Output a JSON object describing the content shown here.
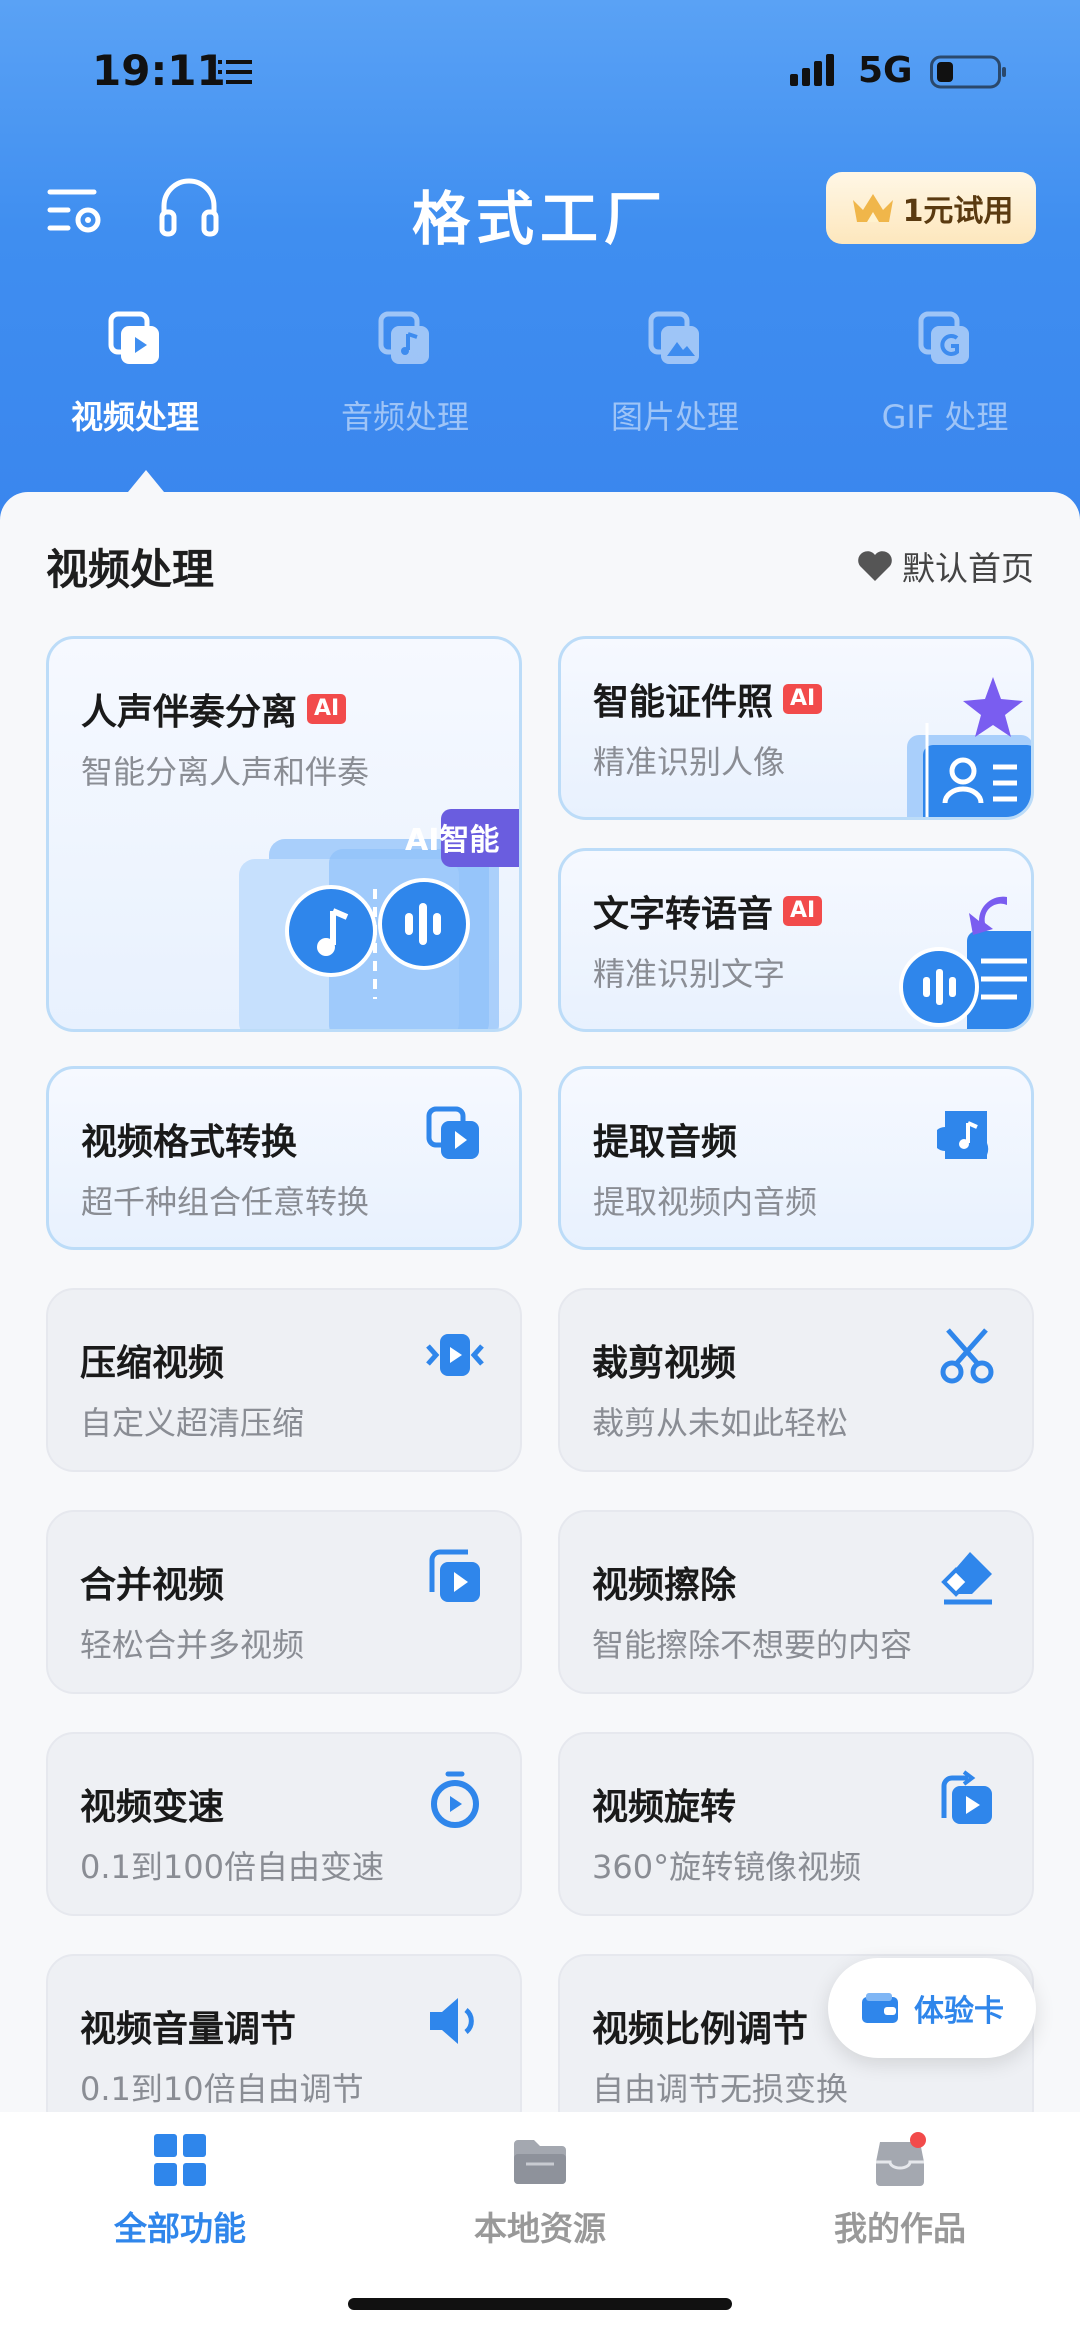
{
  "status_bar": {
    "time": "19:11",
    "network": "5G"
  },
  "top_bar": {
    "title": "格式工厂",
    "trial_button": "1元试用"
  },
  "categories": [
    {
      "label": "视频处理",
      "icon": "video-icon",
      "active": true
    },
    {
      "label": "音频处理",
      "icon": "audio-icon",
      "active": false
    },
    {
      "label": "图片处理",
      "icon": "image-icon",
      "active": false
    },
    {
      "label": "GIF 处理",
      "icon": "gif-icon",
      "active": false
    }
  ],
  "section": {
    "title": "视频处理",
    "default_home": "默认首页"
  },
  "feature_cards": {
    "vocal_separation": {
      "title": "人声伴奏分离",
      "subtitle": "智能分离人声和伴奏",
      "badge": "AI",
      "art_label": "AI智能"
    },
    "id_photo": {
      "title": "智能证件照",
      "subtitle": "精准识别人像",
      "badge": "AI"
    },
    "text_to_speech": {
      "title": "文字转语音",
      "subtitle": "精准识别文字",
      "badge": "AI"
    }
  },
  "tools": [
    {
      "title": "视频格式转换",
      "subtitle": "超千种组合任意转换",
      "icon": "video-convert-icon"
    },
    {
      "title": "提取音频",
      "subtitle": "提取视频内音频",
      "icon": "music-note-icon"
    },
    {
      "title": "压缩视频",
      "subtitle": "自定义超清压缩",
      "icon": "compress-icon"
    },
    {
      "title": "裁剪视频",
      "subtitle": "裁剪从未如此轻松",
      "icon": "scissors-icon"
    },
    {
      "title": "合并视频",
      "subtitle": "轻松合并多视频",
      "icon": "merge-icon"
    },
    {
      "title": "视频擦除",
      "subtitle": "智能擦除不想要的内容",
      "icon": "eraser-icon"
    },
    {
      "title": "视频变速",
      "subtitle": "0.1到100倍自由变速",
      "icon": "speed-icon"
    },
    {
      "title": "视频旋转",
      "subtitle": "360°旋转镜像视频",
      "icon": "rotate-icon"
    },
    {
      "title": "视频音量调节",
      "subtitle": "0.1到10倍自由调节",
      "icon": "volume-icon"
    },
    {
      "title": "视频比例调节",
      "subtitle": "自由调节无损变换",
      "icon": "ratio-icon"
    }
  ],
  "floating": {
    "label": "体验卡"
  },
  "tab_bar": [
    {
      "label": "全部功能",
      "icon": "grid-icon",
      "active": true
    },
    {
      "label": "本地资源",
      "icon": "folder-icon",
      "active": false
    },
    {
      "label": "我的作品",
      "icon": "works-icon",
      "active": false
    }
  ],
  "colors": {
    "primary": "#2f86eb",
    "header": "#3f8ef0",
    "ai_badge": "#f24b4b"
  }
}
